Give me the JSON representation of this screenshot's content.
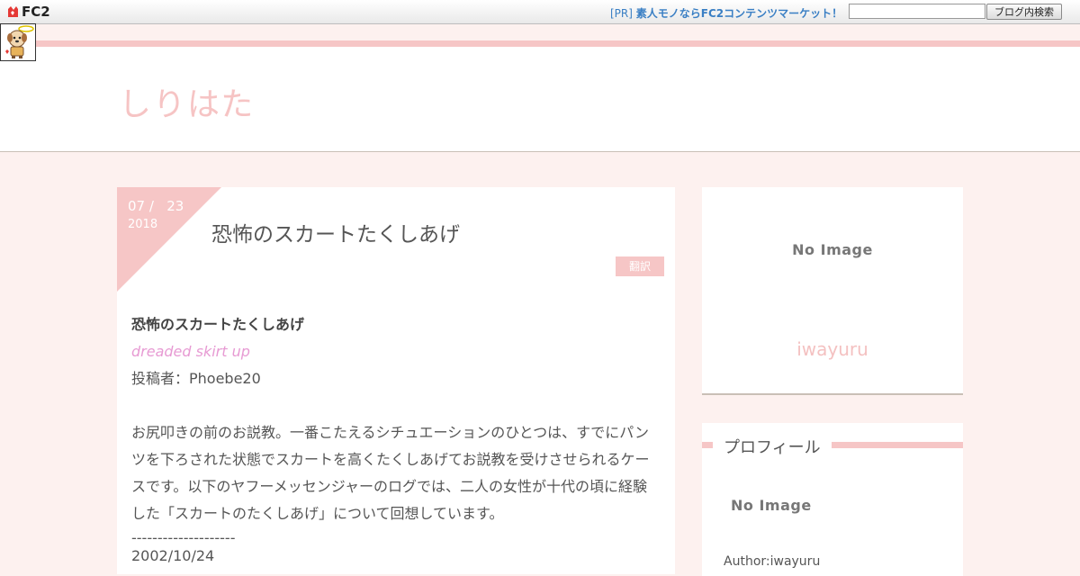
{
  "fc2bar": {
    "logo_text": "FC2",
    "pr_prefix": "[PR]",
    "pr_text": "素人モノならFC2コンテンツマーケット！",
    "search_value": "",
    "search_button": "ブログ内検索"
  },
  "header": {
    "site_title": "しりはた"
  },
  "article": {
    "date_md": "07 /   23",
    "date_year": "2018",
    "title": "恐怖のスカートたくしあげ",
    "translate_label": "翻訳",
    "heading": "恐怖のスカートたくしあげ",
    "english_title": "dreaded skirt up",
    "poster": "投稿者：Phoebe20",
    "paragraph_lines": [
      "お尻叩きの前のお説教。一番こたえるシチュエーションのひとつは、すでにパン",
      "ツを下ろされた状態でスカートを高くたくしあげてお説教を受けさせられるケー",
      "スです。以下のヤフーメッセンジャーのログでは、二人の女性が十代の頃に経験",
      "した「スカートのたくしあげ」について回想しています。"
    ],
    "separator": "--------------------",
    "log_date": "2002/10/24"
  },
  "sidebar": {
    "box1_noimage": "No Image",
    "box1_author": "iwayuru",
    "profile_title": "プロフィール",
    "profile_noimage": "No Image",
    "profile_author": "Author:iwayuru"
  },
  "colors": {
    "accent_pink": "#f6c6c6",
    "background": "#fdf1ef",
    "link_blue": "#3a7fc4",
    "english_pink": "#e79ad3"
  }
}
